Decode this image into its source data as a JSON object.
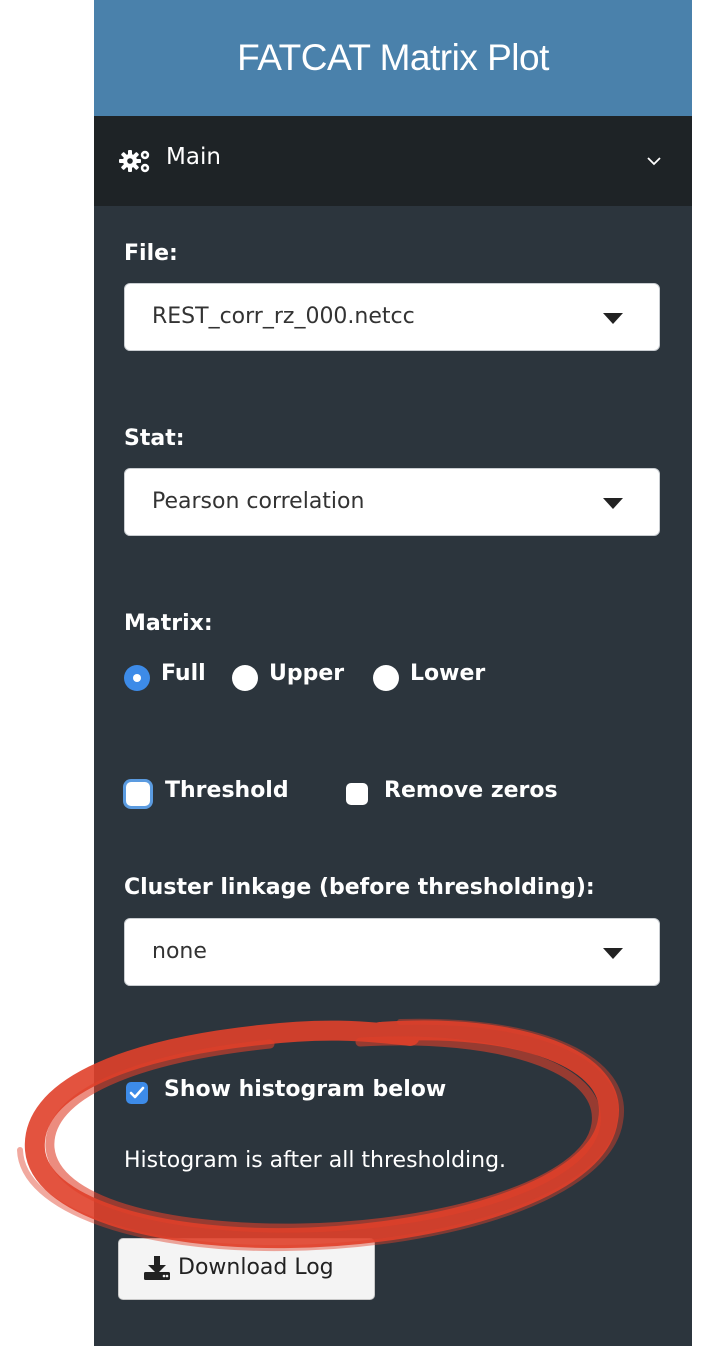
{
  "header": {
    "title": "FATCAT Matrix Plot"
  },
  "menu": {
    "label": "Main",
    "icon": "gears-icon",
    "chevron": "chevron-down-icon"
  },
  "file": {
    "label": "File:",
    "value": "REST_corr_rz_000.netcc"
  },
  "stat": {
    "label": "Stat:",
    "value": "Pearson correlation"
  },
  "matrix": {
    "label": "Matrix:",
    "options": [
      "Full",
      "Upper",
      "Lower"
    ],
    "selected": "Full"
  },
  "threshold": {
    "label": "Threshold",
    "checked": false
  },
  "remove_zeros": {
    "label": "Remove zeros",
    "checked": false
  },
  "cluster": {
    "label": "Cluster linkage (before thresholding):",
    "value": "none"
  },
  "histogram": {
    "label": "Show histogram below",
    "checked": true
  },
  "help_text": "Histogram is after all thresholding.",
  "download": {
    "label": "Download Log",
    "icon": "download-icon"
  },
  "colors": {
    "header_bg": "#4a81ab",
    "panel_bg": "#2c353d",
    "menu_bg": "#1e2326",
    "accent": "#3d8be8",
    "annotation": "#e0402a"
  }
}
